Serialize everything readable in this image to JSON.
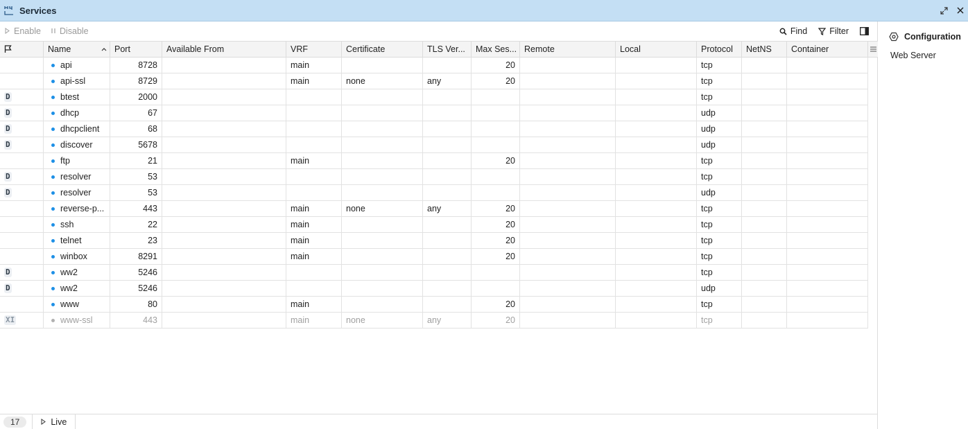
{
  "window": {
    "title": "Services",
    "icon": "network-ports-icon"
  },
  "toolbar": {
    "enable_label": "Enable",
    "disable_label": "Disable",
    "find_label": "Find",
    "filter_label": "Filter"
  },
  "table": {
    "columns": [
      "",
      "Name",
      "Port",
      "Available From",
      "VRF",
      "Certificate",
      "TLS Ver...",
      "Max Ses...",
      "Remote",
      "Local",
      "Protocol",
      "NetNS",
      "Container"
    ],
    "sort_column": "Name",
    "sort_direction": "ascending",
    "rows": [
      {
        "flag": "",
        "name": "api",
        "port": "8728",
        "available_from": "",
        "vrf": "main",
        "certificate": "",
        "tls_version": "",
        "max_sessions": "20",
        "remote": "",
        "local": "",
        "protocol": "tcp",
        "netns": "",
        "container": "",
        "disabled": false
      },
      {
        "flag": "",
        "name": "api-ssl",
        "port": "8729",
        "available_from": "",
        "vrf": "main",
        "certificate": "none",
        "tls_version": "any",
        "max_sessions": "20",
        "remote": "",
        "local": "",
        "protocol": "tcp",
        "netns": "",
        "container": "",
        "disabled": false
      },
      {
        "flag": "D",
        "name": "btest",
        "port": "2000",
        "available_from": "",
        "vrf": "",
        "certificate": "",
        "tls_version": "",
        "max_sessions": "",
        "remote": "",
        "local": "",
        "protocol": "tcp",
        "netns": "",
        "container": "",
        "disabled": false
      },
      {
        "flag": "D",
        "name": "dhcp",
        "port": "67",
        "available_from": "",
        "vrf": "",
        "certificate": "",
        "tls_version": "",
        "max_sessions": "",
        "remote": "",
        "local": "",
        "protocol": "udp",
        "netns": "",
        "container": "",
        "disabled": false
      },
      {
        "flag": "D",
        "name": "dhcpclient",
        "port": "68",
        "available_from": "",
        "vrf": "",
        "certificate": "",
        "tls_version": "",
        "max_sessions": "",
        "remote": "",
        "local": "",
        "protocol": "udp",
        "netns": "",
        "container": "",
        "disabled": false
      },
      {
        "flag": "D",
        "name": "discover",
        "port": "5678",
        "available_from": "",
        "vrf": "",
        "certificate": "",
        "tls_version": "",
        "max_sessions": "",
        "remote": "",
        "local": "",
        "protocol": "udp",
        "netns": "",
        "container": "",
        "disabled": false
      },
      {
        "flag": "",
        "name": "ftp",
        "port": "21",
        "available_from": "",
        "vrf": "main",
        "certificate": "",
        "tls_version": "",
        "max_sessions": "20",
        "remote": "",
        "local": "",
        "protocol": "tcp",
        "netns": "",
        "container": "",
        "disabled": false
      },
      {
        "flag": "D",
        "name": "resolver",
        "port": "53",
        "available_from": "",
        "vrf": "",
        "certificate": "",
        "tls_version": "",
        "max_sessions": "",
        "remote": "",
        "local": "",
        "protocol": "tcp",
        "netns": "",
        "container": "",
        "disabled": false
      },
      {
        "flag": "D",
        "name": "resolver",
        "port": "53",
        "available_from": "",
        "vrf": "",
        "certificate": "",
        "tls_version": "",
        "max_sessions": "",
        "remote": "",
        "local": "",
        "protocol": "udp",
        "netns": "",
        "container": "",
        "disabled": false
      },
      {
        "flag": "",
        "name": "reverse-p...",
        "port": "443",
        "available_from": "",
        "vrf": "main",
        "certificate": "none",
        "tls_version": "any",
        "max_sessions": "20",
        "remote": "",
        "local": "",
        "protocol": "tcp",
        "netns": "",
        "container": "",
        "disabled": false
      },
      {
        "flag": "",
        "name": "ssh",
        "port": "22",
        "available_from": "",
        "vrf": "main",
        "certificate": "",
        "tls_version": "",
        "max_sessions": "20",
        "remote": "",
        "local": "",
        "protocol": "tcp",
        "netns": "",
        "container": "",
        "disabled": false
      },
      {
        "flag": "",
        "name": "telnet",
        "port": "23",
        "available_from": "",
        "vrf": "main",
        "certificate": "",
        "tls_version": "",
        "max_sessions": "20",
        "remote": "",
        "local": "",
        "protocol": "tcp",
        "netns": "",
        "container": "",
        "disabled": false
      },
      {
        "flag": "",
        "name": "winbox",
        "port": "8291",
        "available_from": "",
        "vrf": "main",
        "certificate": "",
        "tls_version": "",
        "max_sessions": "20",
        "remote": "",
        "local": "",
        "protocol": "tcp",
        "netns": "",
        "container": "",
        "disabled": false
      },
      {
        "flag": "D",
        "name": "ww2",
        "port": "5246",
        "available_from": "",
        "vrf": "",
        "certificate": "",
        "tls_version": "",
        "max_sessions": "",
        "remote": "",
        "local": "",
        "protocol": "tcp",
        "netns": "",
        "container": "",
        "disabled": false
      },
      {
        "flag": "D",
        "name": "ww2",
        "port": "5246",
        "available_from": "",
        "vrf": "",
        "certificate": "",
        "tls_version": "",
        "max_sessions": "",
        "remote": "",
        "local": "",
        "protocol": "udp",
        "netns": "",
        "container": "",
        "disabled": false
      },
      {
        "flag": "",
        "name": "www",
        "port": "80",
        "available_from": "",
        "vrf": "main",
        "certificate": "",
        "tls_version": "",
        "max_sessions": "20",
        "remote": "",
        "local": "",
        "protocol": "tcp",
        "netns": "",
        "container": "",
        "disabled": false
      },
      {
        "flag": "XI",
        "name": "www-ssl",
        "port": "443",
        "available_from": "",
        "vrf": "main",
        "certificate": "none",
        "tls_version": "any",
        "max_sessions": "20",
        "remote": "",
        "local": "",
        "protocol": "tcp",
        "netns": "",
        "container": "",
        "disabled": true
      }
    ]
  },
  "statusbar": {
    "count": "17",
    "live_label": "Live"
  },
  "side_panel": {
    "header": "Configuration",
    "items": [
      "Web Server"
    ]
  },
  "colors": {
    "titlebar_bg": "#c4dff4",
    "accent_dot": "#1e90e6",
    "disabled_text": "#a0a0a0"
  }
}
